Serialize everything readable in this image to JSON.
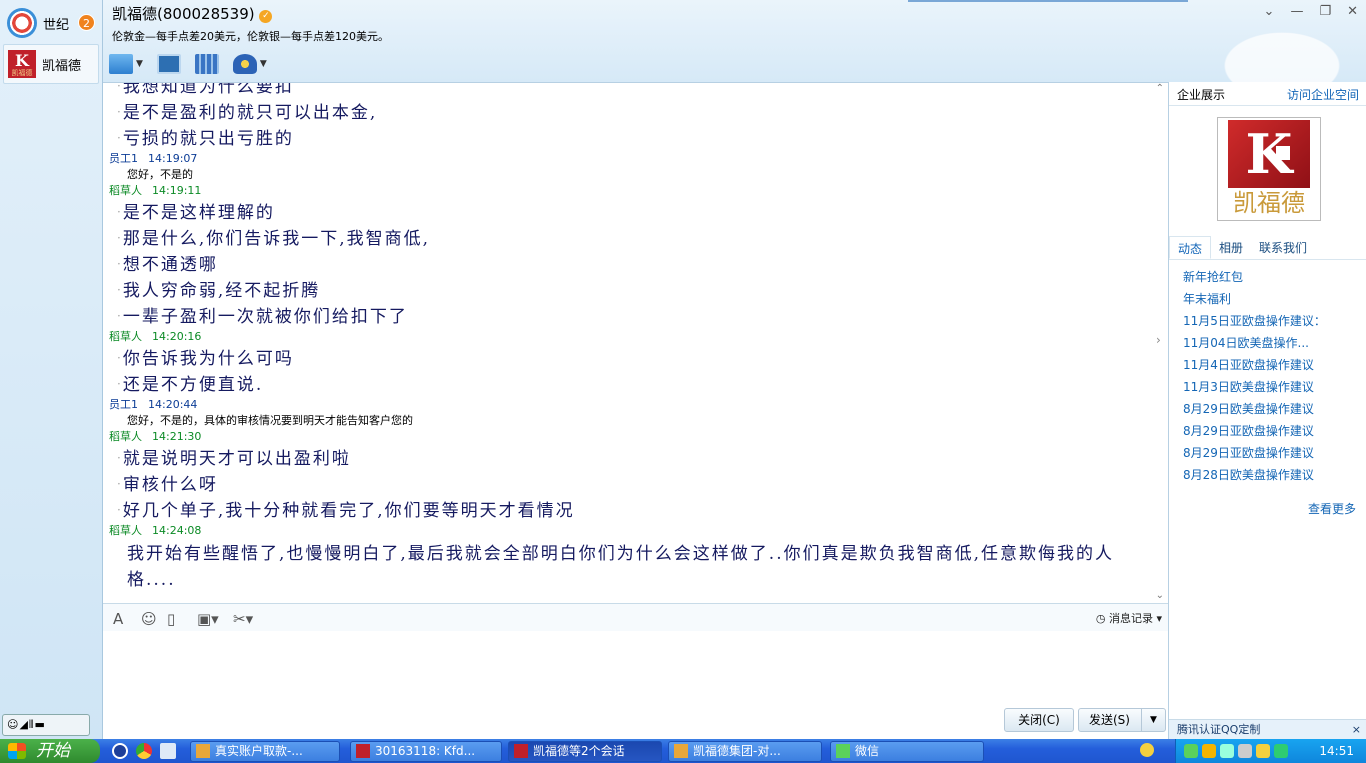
{
  "contacts": [
    {
      "name": "世纪",
      "badge": "2"
    },
    {
      "name": "凯福德",
      "logo_letter": "K",
      "logo_sub": "凯福德"
    }
  ],
  "header": {
    "title": "凯福德(800028539)",
    "subtitle": "伦敦金—每手点差20美元，伦敦银—每手点差120美元。"
  },
  "chat": {
    "messages": [
      {
        "type": "lines",
        "lines": [
          "是不是盈利的就只可以出本金,",
          "亏损的就只出亏胜的"
        ]
      },
      {
        "type": "head",
        "sender": "员工1",
        "time": "14:19:07",
        "role": "emp"
      },
      {
        "type": "small",
        "text": "您好，不是的"
      },
      {
        "type": "head",
        "sender": "稻草人",
        "time": "14:19:11",
        "role": "cus"
      },
      {
        "type": "lines",
        "lines": [
          "是不是这样理解的",
          "那是什么,你们告诉我一下,我智商低,",
          "想不通透哪",
          "我人穷命弱,经不起折腾",
          "一辈子盈利一次就被你们给扣下了"
        ]
      },
      {
        "type": "head",
        "sender": "稻草人",
        "time": "14:20:16",
        "role": "cus"
      },
      {
        "type": "lines",
        "lines": [
          "你告诉我为什么可吗",
          "还是不方便直说."
        ]
      },
      {
        "type": "head",
        "sender": "员工1",
        "time": "14:20:44",
        "role": "emp"
      },
      {
        "type": "small",
        "text": "您好，不是的，具体的审核情况要到明天才能告知客户您的"
      },
      {
        "type": "head",
        "sender": "稻草人",
        "time": "14:21:30",
        "role": "cus"
      },
      {
        "type": "lines",
        "lines": [
          "就是说明天才可以出盈利啦",
          "审核什么呀",
          "好几个单子,我十分种就看完了,你们要等明天才看情况"
        ]
      },
      {
        "type": "head",
        "sender": "稻草人",
        "time": "14:24:08",
        "role": "cus"
      },
      {
        "type": "para",
        "text": "我开始有些醒悟了,也慢慢明白了,最后我就会全部明白你们为什么会这样做了..你们真是欺负我智商低,任意欺侮我的人格...."
      }
    ]
  },
  "input": {
    "history_label": "消息记录",
    "close_label": "关闭(C)",
    "send_label": "发送(S)"
  },
  "right_panel": {
    "title": "企业展示",
    "link": "访问企业空间",
    "logo_letter": "K",
    "logo_text": "凯福德",
    "tabs": [
      "动态",
      "相册",
      "联系我们"
    ],
    "news": [
      "新年抢红包",
      "年末福利",
      "11月5日亚欧盘操作建议：",
      "11月04日欧美盘操作...",
      "11月4日亚欧盘操作建议",
      "11月3日欧美盘操作建议",
      "8月29日欧美盘操作建议",
      "8月29日亚欧盘操作建议",
      "8月29日亚欧盘操作建议",
      "8月28日欧美盘操作建议"
    ],
    "see_more": "查看更多",
    "footer": "腾讯认证QQ定制",
    "footer_close": "×"
  },
  "taskbar": {
    "start_label": "开始",
    "tasks": [
      "真实账户取款-...",
      "30163118: Kfd...",
      "凯福德等2个会话",
      "凯福德集团-对...",
      "微信"
    ],
    "active_task": 2,
    "clock": "14:51"
  },
  "colors": {
    "accent": "#1466b5",
    "employee_name": "#0d3d96",
    "customer_name": "#0b8a25",
    "message_text": "#151a60",
    "badge": "#f0831e",
    "brand_red": "#c0202a"
  }
}
